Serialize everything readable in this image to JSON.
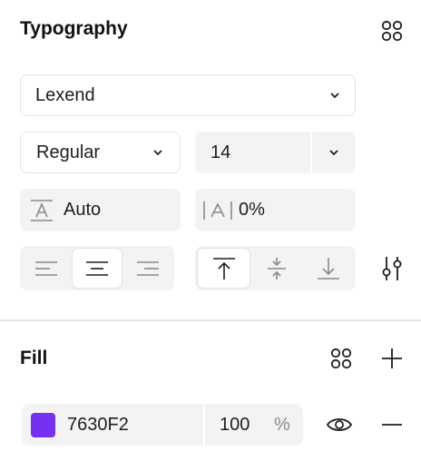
{
  "typography": {
    "title": "Typography",
    "font_family": "Lexend",
    "font_weight": "Regular",
    "font_size": "14",
    "line_height": "Auto",
    "letter_spacing": "0%"
  },
  "fill": {
    "title": "Fill",
    "color_hex": "7630F2",
    "swatch_color": "#7630F2",
    "opacity": "100",
    "opacity_unit": "%"
  },
  "icons": {
    "styles": "four-dots-icon",
    "dropdown": "chevron-down-icon",
    "line_height": "line-height-icon",
    "letter_spacing": "letter-spacing-icon",
    "align_left": "align-left-icon",
    "align_center": "align-center-icon",
    "align_right": "align-right-icon",
    "valign_top": "vertical-align-top-icon",
    "valign_middle": "vertical-align-middle-icon",
    "valign_bottom": "vertical-align-bottom-icon",
    "text_settings": "sliders-icon",
    "add": "plus-icon",
    "visibility": "eye-icon",
    "remove": "minus-icon"
  }
}
